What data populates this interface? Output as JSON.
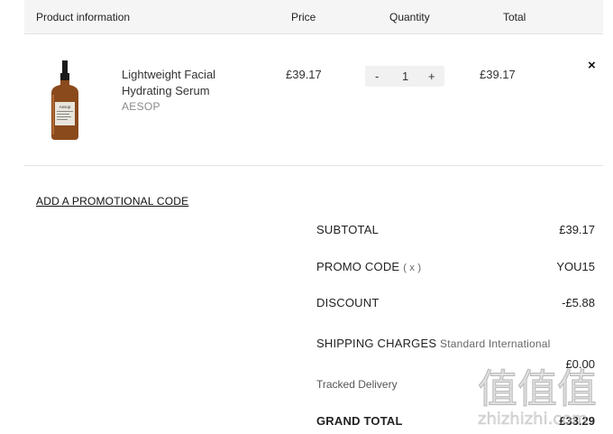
{
  "header": {
    "product_info": "Product information",
    "price": "Price",
    "quantity": "Quantity",
    "total": "Total"
  },
  "item": {
    "name": "Lightweight Facial Hydrating Serum",
    "brand": "AESOP",
    "price": "£39.17",
    "quantity": "1",
    "qty_minus": "-",
    "qty_plus": "+",
    "total": "£39.17",
    "remove_icon": "×",
    "bottle_label": "Aesop"
  },
  "promo_link": "ADD A PROMOTIONAL CODE",
  "summary": {
    "subtotal_label": "SUBTOTAL",
    "subtotal_value": "£39.17",
    "promo_label": "PROMO CODE",
    "promo_remove": "( x )",
    "promo_value": "YOU15",
    "discount_label": "DISCOUNT",
    "discount_value": "-£5.88",
    "shipping_label": "SHIPPING CHARGES",
    "shipping_method": "Standard International",
    "shipping_method_2": "Tracked Delivery",
    "shipping_value": "£0.00",
    "grand_label": "GRAND TOTAL",
    "grand_value": "£33.29"
  },
  "watermark": {
    "glyphs": "值值值",
    "site": "zhizhizhi.com"
  },
  "colors": {
    "header_bg": "#f5f5f5",
    "qty_bg": "#f1f1f1",
    "bottle": "#8a4a1c"
  }
}
